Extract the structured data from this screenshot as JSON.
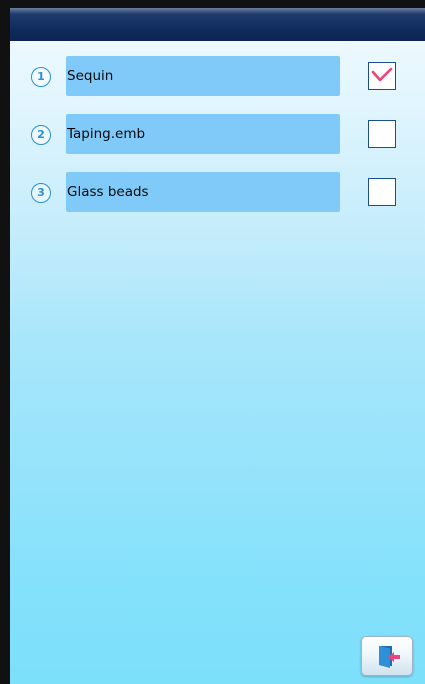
{
  "options": [
    {
      "number": "1",
      "label": "Sequin",
      "checked": true
    },
    {
      "number": "2",
      "label": "Taping.emb",
      "checked": false
    },
    {
      "number": "3",
      "label": "Glass beads",
      "checked": false
    }
  ],
  "icons": {
    "checkmark": "checkmark-icon",
    "exit": "exit-door-icon"
  },
  "colors": {
    "title_bar": "#102a5c",
    "field_bg": "#7fcaf9",
    "check_mark": "#e8467c",
    "number_circle": "#2a8fd6"
  }
}
